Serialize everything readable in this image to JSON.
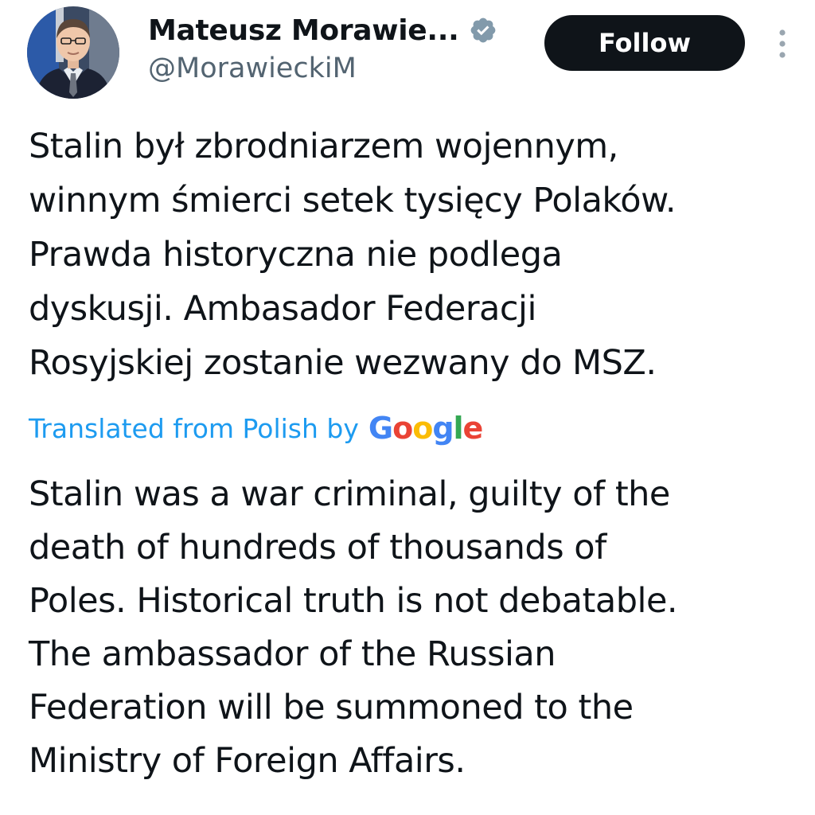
{
  "author": {
    "display_name": "Mateusz Morawie...",
    "handle": "@MorawieckiM",
    "verified_icon": "verified-badge-icon",
    "avatar": "profile-photo"
  },
  "actions": {
    "follow_label": "Follow",
    "more_icon": "more-vertical-icon"
  },
  "tweet": {
    "lines": [
      "Stalin był zbrodniarzem wojennym,",
      "winnym śmierci setek tysięcy Polaków.",
      "Prawda historyczna nie podlega",
      "dyskusji. Ambasador Federacji",
      "Rosyjskiej zostanie wezwany do MSZ."
    ]
  },
  "translation": {
    "label": "Translated from Polish by",
    "provider": "Google",
    "provider_colors": [
      "#4285F4",
      "#EA4335",
      "#FBBC05",
      "#4285F4",
      "#34A853",
      "#EA4335"
    ],
    "lines": [
      "Stalin was a war criminal, guilty of the",
      "death of hundreds of thousands of",
      "Poles. Historical truth is not debatable.",
      "The ambassador of the Russian",
      "Federation will be summoned to the",
      "Ministry of Foreign Affairs."
    ]
  },
  "colors": {
    "text": "#0f1419",
    "secondary": "#536471",
    "link": "#1d9bf0",
    "button_bg": "#0f1419",
    "badge": "#829aab"
  }
}
